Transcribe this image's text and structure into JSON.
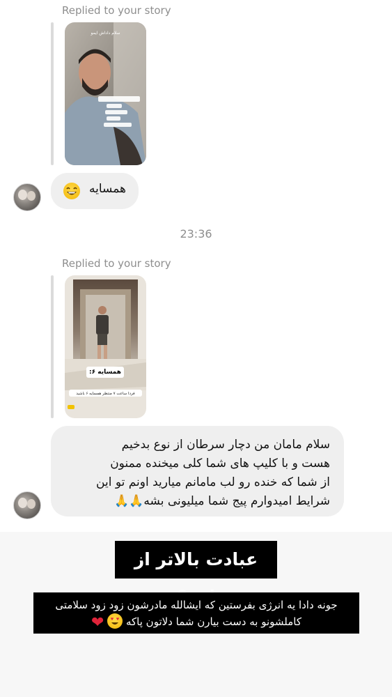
{
  "messages": [
    {
      "replied_label": "Replied to your story",
      "story_top_text": "سلام داداش ایمو",
      "bubble_text": "همسایه",
      "bubble_emoji": "grinning-face-icon"
    },
    {
      "replied_label": "Replied to your story",
      "story_badge": "همسایه ۶:",
      "story_bottom_text": "فردا ساعت ۷ منتظر همسایه ۶ باشید",
      "bubble_lines": [
        "سلام مامان من دچار سرطان از نوع بدخیم",
        "هست و با کلیپ های شما کلی میخنده ممنون",
        "از شما که خنده رو لب مامانم میارید اونم تو این",
        "شرایط امیدوارم پیج شما میلیونی بشه🙏🙏"
      ]
    }
  ],
  "timestamp": "23:36",
  "caption": {
    "title": "عبادت بالاتر از این؟",
    "body_line1": "جونه دادا یه انرژی بفرستین که ایشالله مادرشون زود زود سلامتی",
    "body_line2": "کاملشونو به دست بیارن شما دلاتون پاکه",
    "emoji_icons": [
      "heart-eyes-face-icon",
      "red-heart-icon"
    ]
  },
  "colors": {
    "bubble_bg": "#efefef",
    "meta_text": "#8e8e8e",
    "reply_bar": "#dbdbdb",
    "caption_bg": "#000000"
  }
}
